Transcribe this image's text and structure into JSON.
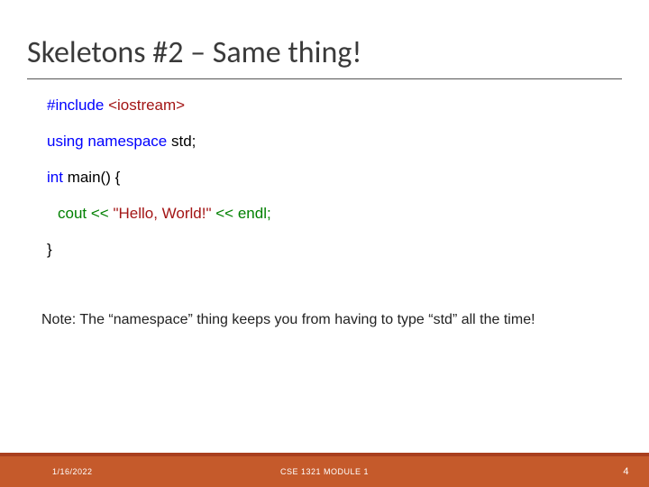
{
  "title": "Skeletons #2 – Same thing!",
  "code": {
    "l1_kw": "#include ",
    "l1_red": "<iostream>",
    "l2_a": "using ",
    "l2_b": "namespace ",
    "l2_c": "std;",
    "l3_a": "int ",
    "l3_b": "main() {",
    "l4_a": "cout ",
    "l4_b": "<< ",
    "l4_c": "\"Hello, World!\" ",
    "l4_d": "<< ",
    "l4_e": "endl;",
    "l5": "}"
  },
  "note": "Note: The “namespace” thing keeps you from having to type “std” all the time!",
  "footer": {
    "date": "1/16/2022",
    "center": "CSE 1321 MODULE 1",
    "page": "4"
  }
}
